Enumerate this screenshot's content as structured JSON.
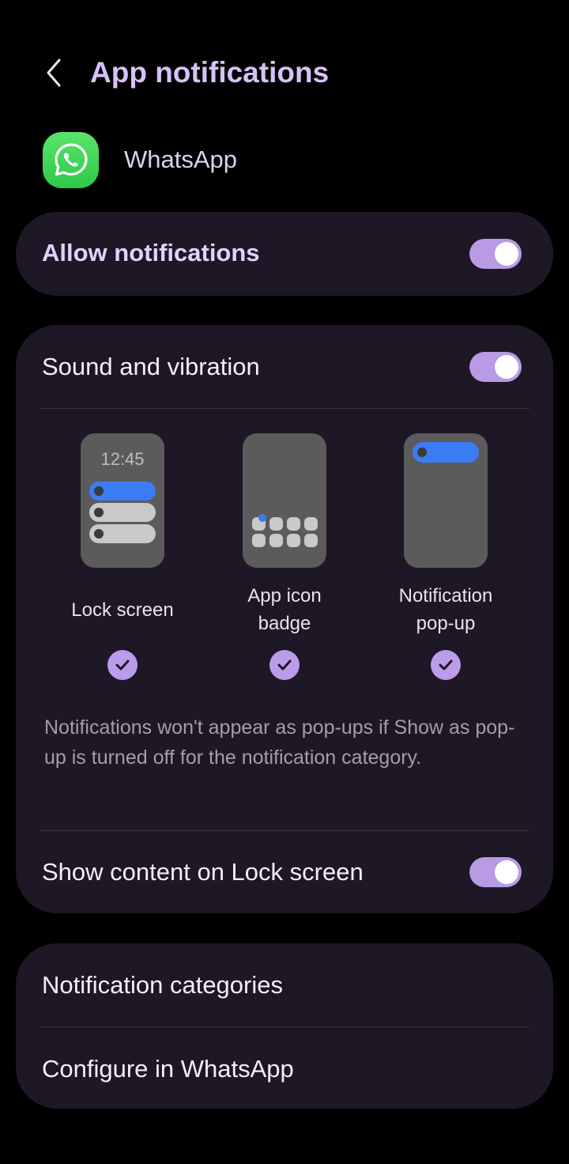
{
  "header": {
    "title": "App notifications",
    "back_icon": "chevron-left-icon"
  },
  "app": {
    "name": "WhatsApp",
    "icon": "whatsapp-logo-icon",
    "icon_color": "#2ec94a"
  },
  "allow_notifications": {
    "label": "Allow notifications",
    "enabled": true
  },
  "sound_vibration": {
    "label": "Sound and vibration",
    "enabled": true
  },
  "notification_styles": [
    {
      "label": "Lock screen",
      "preview_time": "12:45",
      "checked": true
    },
    {
      "label": "App icon\nbadge",
      "checked": true
    },
    {
      "label": "Notification\npop-up",
      "checked": true
    }
  ],
  "info_text": "Notifications won't appear as pop-ups if Show as pop-up is turned off for the notification category.",
  "show_content_lock_screen": {
    "label": "Show content on Lock screen",
    "enabled": true
  },
  "more": {
    "notification_categories": "Notification categories",
    "configure_in_app": "Configure in WhatsApp"
  },
  "colors": {
    "accent": "#b89ae5",
    "title": "#d7c1f6",
    "card_bg": "#1e1726",
    "blue": "#3b7cf5"
  }
}
